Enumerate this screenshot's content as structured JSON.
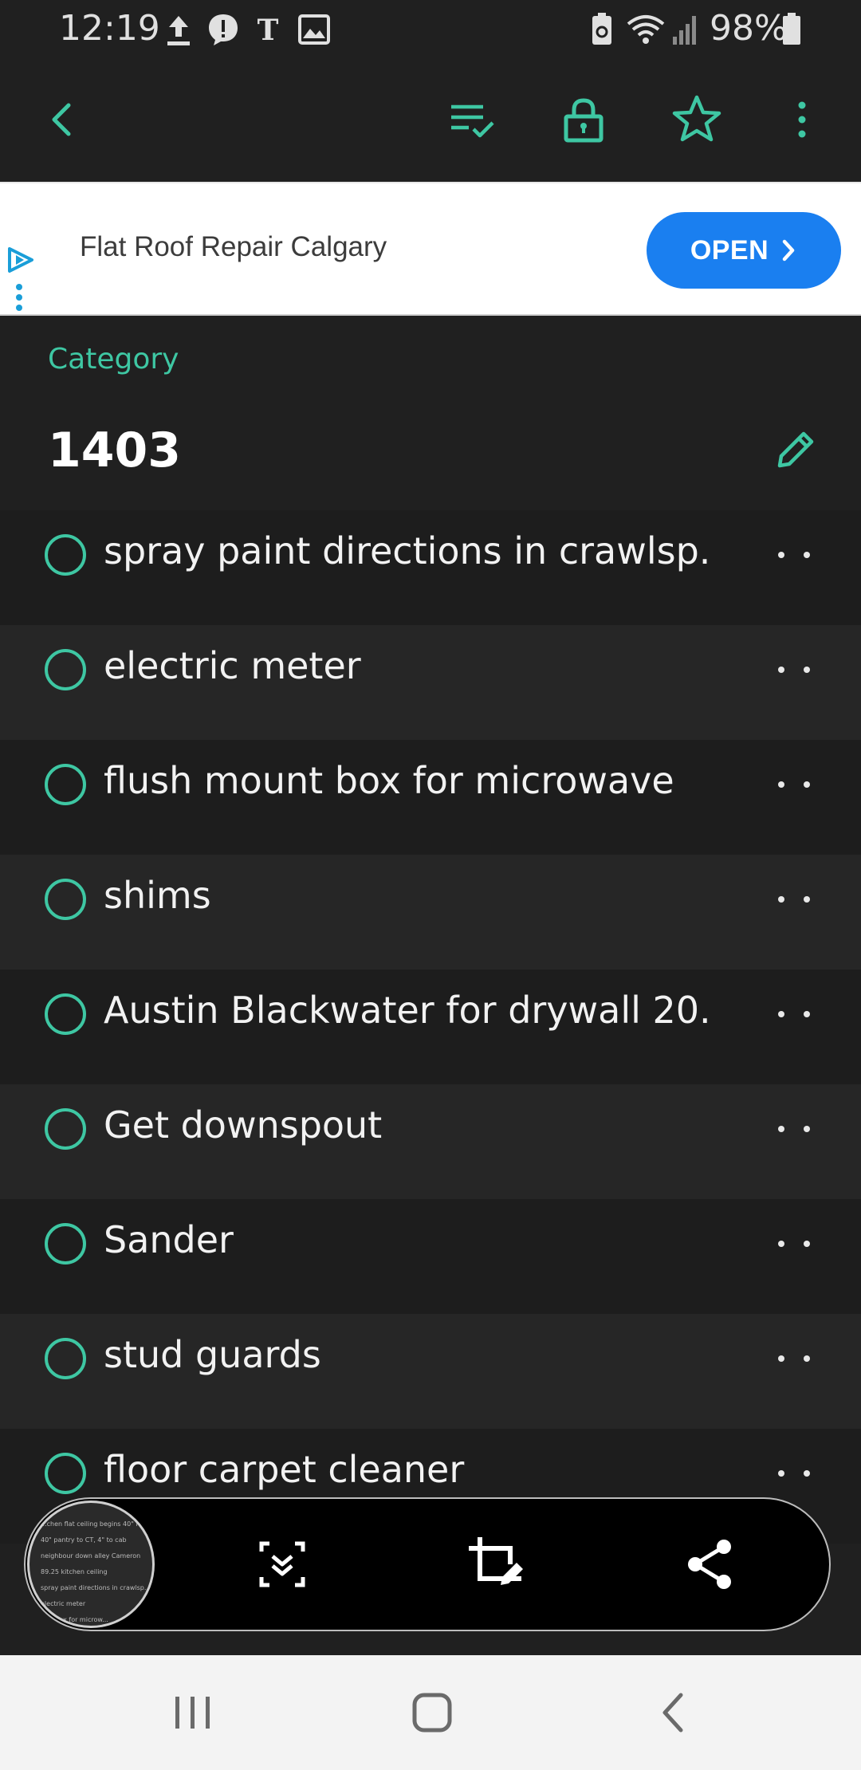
{
  "status_bar": {
    "time": "12:19",
    "battery": "98%",
    "icons": [
      "upload-icon",
      "alert-icon",
      "nyt-icon",
      "image-icon",
      "battery-saver-icon",
      "wifi-icon",
      "signal-icon",
      "battery-icon"
    ]
  },
  "app_bar": {
    "icons": [
      "back-icon",
      "checklist-icon",
      "lock-icon",
      "star-icon",
      "more-vertical-icon"
    ]
  },
  "ad": {
    "text": "Flat Roof Repair Calgary",
    "button": "OPEN"
  },
  "header": {
    "label": "Category",
    "title": "1403"
  },
  "items": [
    {
      "label": "spray paint directions in crawlsp..."
    },
    {
      "label": "electric meter"
    },
    {
      "label": "flush mount box for microwave"
    },
    {
      "label": "shims"
    },
    {
      "label": "Austin Blackwater for drywall 20..."
    },
    {
      "label": "Get downspout"
    },
    {
      "label": "Sander"
    },
    {
      "label": "stud guards"
    },
    {
      "label": "floor carpet cleaner"
    }
  ],
  "screenshot_toolbar": {
    "thumbnail_lines": [
      "...chen flat ceiling begins 40\" from",
      "40\" pantry to CT, 4\" to cab",
      "neighbour down alley Cameron",
      "89.25 kitchen ceiling",
      "spray paint directions in crawlsp...",
      "electric meter",
      "...nt box for microw..."
    ],
    "tools": [
      "scroll-capture-icon",
      "crop-edit-icon",
      "share-icon"
    ]
  },
  "nav_bar": {
    "buttons": [
      "recents-button",
      "home-button",
      "back-button"
    ]
  },
  "colors": {
    "accent": "#3ec7a3",
    "background": "#202020",
    "ad_button": "#1a7ff0"
  }
}
